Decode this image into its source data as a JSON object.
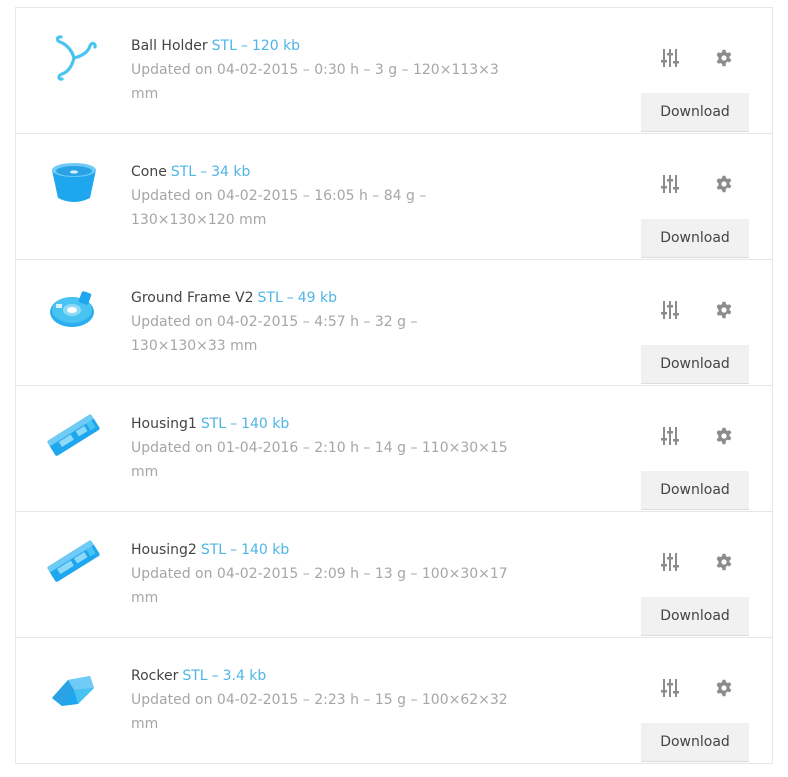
{
  "accent_color": "#4fb5e6",
  "models": [
    {
      "name": "Ball Holder",
      "format": "STL",
      "size": "120 kb",
      "details": "Updated on 04-02-2015 – 0:30 h – 3 g – 120×113×3 mm",
      "download_label": "Download",
      "thumbnail": "ball-holder-model-icon"
    },
    {
      "name": "Cone",
      "format": "STL",
      "size": "34 kb",
      "details": "Updated on 04-02-2015 – 16:05 h – 84 g – 130×130×120 mm",
      "download_label": "Download",
      "thumbnail": "cone-model-icon"
    },
    {
      "name": "Ground Frame V2",
      "format": "STL",
      "size": "49 kb",
      "details": "Updated on 04-02-2015 – 4:57 h – 32 g – 130×130×33 mm",
      "download_label": "Download",
      "thumbnail": "ground-frame-model-icon"
    },
    {
      "name": "Housing1",
      "format": "STL",
      "size": "140 kb",
      "details": "Updated on 01-04-2016 – 2:10 h – 14 g – 110×30×15 mm",
      "download_label": "Download",
      "thumbnail": "housing-model-icon"
    },
    {
      "name": "Housing2",
      "format": "STL",
      "size": "140 kb",
      "details": "Updated on 04-02-2015 – 2:09 h – 13 g – 100×30×17 mm",
      "download_label": "Download",
      "thumbnail": "housing-model-icon"
    },
    {
      "name": "Rocker",
      "format": "STL",
      "size": "3.4 kb",
      "details": "Updated on 04-02-2015 – 2:23 h – 15 g – 100×62×32 mm",
      "download_label": "Download",
      "thumbnail": "rocker-model-icon"
    }
  ]
}
